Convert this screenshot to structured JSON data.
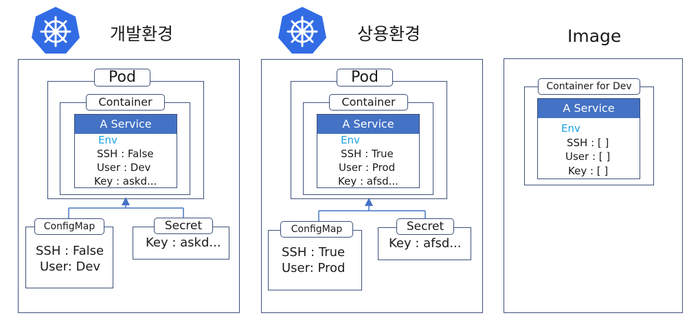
{
  "colors": {
    "k8s_blue": "#326ce5",
    "service_header": "#4472c4",
    "env_text": "#1aa3e0",
    "border": "#3b4f7a"
  },
  "icons": {
    "logo": "kubernetes-helm-icon"
  },
  "dev": {
    "title": "개발환경",
    "pod_label": "Pod",
    "container_label": "Container",
    "service_label": "A Service",
    "env_label": "Env",
    "env_lines": [
      "SSH : False",
      "User : Dev",
      "Key : askd..."
    ],
    "configmap_label": "ConfigMap",
    "configmap_lines": [
      "SSH : False",
      "User: Dev"
    ],
    "secret_label": "Secret",
    "secret_lines": [
      "Key : askd..."
    ]
  },
  "prod": {
    "title": "상용환경",
    "pod_label": "Pod",
    "container_label": "Container",
    "service_label": "A Service",
    "env_label": "Env",
    "env_lines": [
      "SSH : True",
      "User : Prod",
      "Key : afsd..."
    ],
    "configmap_label": "ConfigMap",
    "configmap_lines": [
      "SSH : True",
      "User: Prod"
    ],
    "secret_label": "Secret",
    "secret_lines": [
      "Key : afsd..."
    ]
  },
  "image": {
    "title": "Image",
    "container_label": "Container for Dev",
    "service_label": "A Service",
    "env_label": "Env",
    "env_lines": [
      "SSH : [ ]",
      "User : [ ]",
      "Key : [ ]"
    ]
  }
}
